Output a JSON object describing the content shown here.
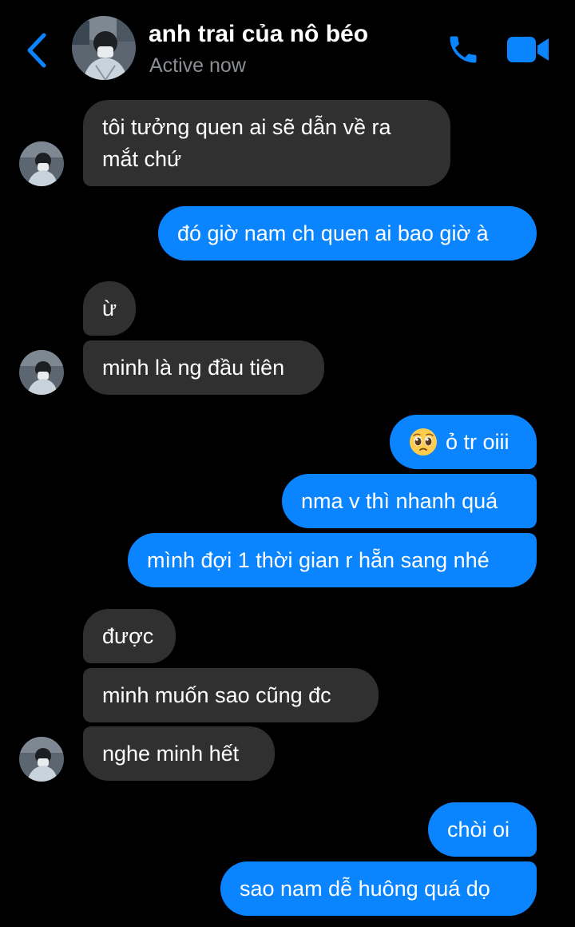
{
  "header": {
    "contact_name": "anh trai của nô béo",
    "status": "Active now",
    "icons": {
      "back": "chevron-left-icon",
      "call": "phone-icon",
      "video": "video-camera-icon"
    },
    "accent_color": "#0a84ff"
  },
  "messages": [
    {
      "direction": "in",
      "text": "tôi tưởng quen ai sẽ dẫn về ra",
      "text2": "mắt chứ"
    },
    {
      "direction": "out",
      "text": "đó giờ nam ch quen ai bao giờ à"
    },
    {
      "direction": "in",
      "text": "ừ"
    },
    {
      "direction": "in",
      "text": "minh là ng đầu tiên"
    },
    {
      "direction": "out",
      "text": "ỏ tr oiii",
      "emoji": "pleading-face-emoji"
    },
    {
      "direction": "out",
      "text": "nma v thì nhanh quá"
    },
    {
      "direction": "out",
      "text": "mình đợi 1 thời gian r hẵn sang nhé"
    },
    {
      "direction": "in",
      "text": "được"
    },
    {
      "direction": "in",
      "text": "minh muốn sao cũng đc"
    },
    {
      "direction": "in",
      "text": "nghe minh hết"
    },
    {
      "direction": "out",
      "text": "chòi oi"
    },
    {
      "direction": "out",
      "text": "sao nam dễ huông quá dọ"
    }
  ],
  "colors": {
    "incoming_bubble": "#303030",
    "outgoing_bubble": "#0a84ff",
    "background": "#000000",
    "status_text": "#8a8d91"
  }
}
